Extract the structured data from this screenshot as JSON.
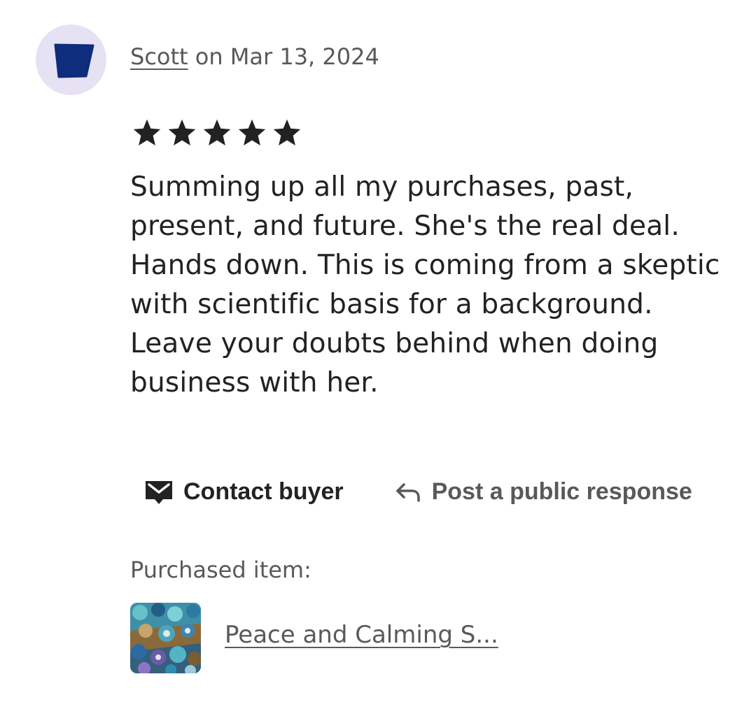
{
  "review": {
    "reviewer_name": "Scott",
    "date_text": "on Mar 13, 2024",
    "rating": 5,
    "rating_max": 5,
    "body": "Summing up all my purchases, past, present, and future. She's the real deal. Hands down. This is coming from a skeptic with scientific basis for a background. Leave your doubts behind when doing business with her."
  },
  "actions": {
    "contact_label": "Contact buyer",
    "respond_label": "Post a public response"
  },
  "purchased": {
    "label": "Purchased item:",
    "item_title": "Peace and Calming S..."
  },
  "colors": {
    "avatar_bg": "#e6e2f3",
    "avatar_shape": "#0e2d7c",
    "text_primary": "#222222",
    "text_secondary": "#595959"
  },
  "icons": {
    "star": "star-icon",
    "contact": "envelope-icon",
    "respond": "reply-arrow-icon"
  }
}
